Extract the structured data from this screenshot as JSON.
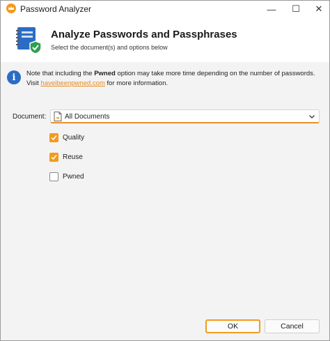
{
  "window": {
    "title": "Password Analyzer",
    "controls": {
      "minimize": "—",
      "maximize": "☐",
      "close": "✕"
    },
    "app_icon": "crown-icon"
  },
  "header": {
    "title": "Analyze Passwords and Passphrases",
    "subtitle": "Select the document(s) and options below",
    "icon": "notebook-shield-icon"
  },
  "info": {
    "icon": "info-icon",
    "text_before": "Note that including the ",
    "text_bold": "Pwned",
    "text_after": " option may take more time depending on the number of passwords. Visit ",
    "link": "haveibeenpwned.com",
    "text_end": " for more information."
  },
  "document": {
    "label": "Document:",
    "value": "All Documents",
    "icon": "document-icon"
  },
  "options": [
    {
      "label": "Quality",
      "checked": true
    },
    {
      "label": "Reuse",
      "checked": true
    },
    {
      "label": "Pwned",
      "checked": false
    }
  ],
  "buttons": {
    "ok": "OK",
    "cancel": "Cancel"
  },
  "colors": {
    "accent": "#f29b1d",
    "info": "#2b6cc4",
    "link": "#e58a1e"
  }
}
